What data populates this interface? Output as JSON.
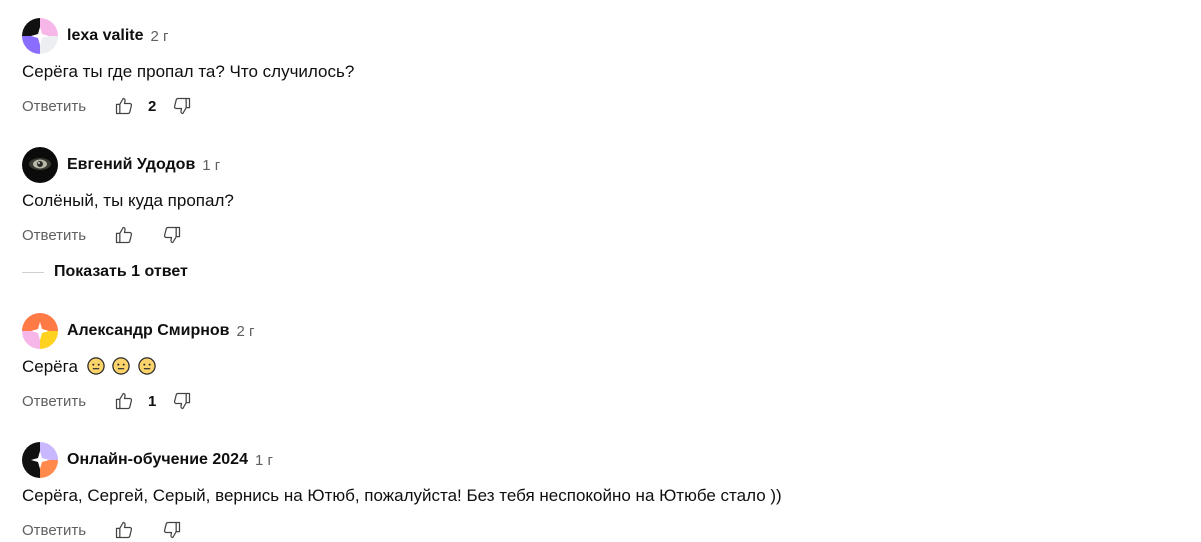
{
  "comments": [
    {
      "author": "lexa valite",
      "time": "2 г",
      "text": "Серёга ты где пропал та? Что случилось?",
      "reply_label": "Ответить",
      "likes": "2"
    },
    {
      "author": "Евгений Удодов",
      "time": "1 г",
      "text": "Солёный, ты куда пропал?",
      "reply_label": "Ответить",
      "likes": ""
    },
    {
      "author": "Александр Смирнов",
      "time": "2 г",
      "text": "Серёга",
      "reply_label": "Ответить",
      "likes": "1"
    },
    {
      "author": "Онлайн-обучение 2024",
      "time": "1 г",
      "text": "Серёга, Сергей, Серый, вернись на Ютюб, пожалуйста! Без тебя неспокойно на Ютюбе стало ))",
      "reply_label": "Ответить",
      "likes": ""
    }
  ],
  "show_replies_label": "Показать 1 ответ",
  "icons": {
    "like": "thumbs-up-icon",
    "dislike": "thumbs-down-icon",
    "emoji": "neutral-face-emoji"
  },
  "colors": {
    "text": "#0f0f0f",
    "secondary": "#606060",
    "emoji_face": "#fcd46b"
  }
}
